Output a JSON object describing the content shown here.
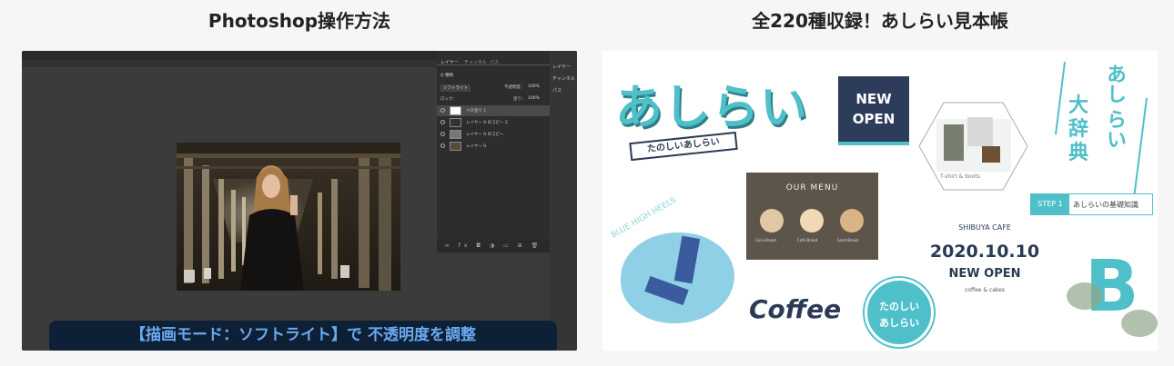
{
  "cards": [
    {
      "title": "Photoshop操作方法",
      "photoshop": {
        "tabs": [
          "レイヤー",
          "チャンネル",
          "パス"
        ],
        "filter_label": "Q 種類",
        "blend_mode": "ソフトライト",
        "opacity_label": "不透明度：",
        "opacity_value": "100%",
        "lock_label": "ロック：",
        "fill_label": "塗り：",
        "fill_value": "100%",
        "layers": [
          {
            "name": "ベタ塗り 1"
          },
          {
            "name": "レイヤー 0 のコピー 2"
          },
          {
            "name": "レイヤー 0 のコピー"
          },
          {
            "name": "レイヤー 0"
          }
        ],
        "side_items": [
          "レイヤー",
          "チャンネル",
          "パス"
        ],
        "caption": "【描画モード：ソフトライト】で 不透明度を調整"
      }
    },
    {
      "title": "全220種収録！あしらい見本帳",
      "decor": {
        "big_word": "あしらい",
        "ribbon": "たのしいあしらい",
        "new_open_1": "NEW",
        "new_open_2": "OPEN",
        "tshirt_caption": "T-shirt & boots",
        "dictionary": [
          "あし",
          "らい",
          "大",
          "辞",
          "典"
        ],
        "menu_title": "OUR MENU",
        "menu_items": [
          "Coco Bread",
          "Café Bread",
          "Sand Bread"
        ],
        "blue_heels": "BLUE HIGH HEELS",
        "step_label": "STEP 1",
        "step_text": "あしらいの基礎知識",
        "cafe_name": "SHIBUYA CAFE",
        "cafe_date": "2020.10.10",
        "cafe_open": "NEW OPEN",
        "cafe_sub": "coffee & cakes",
        "coffee": "Coffee",
        "circle_text_1": "たのしい",
        "circle_text_2": "あしらい",
        "letter": "B"
      }
    }
  ]
}
